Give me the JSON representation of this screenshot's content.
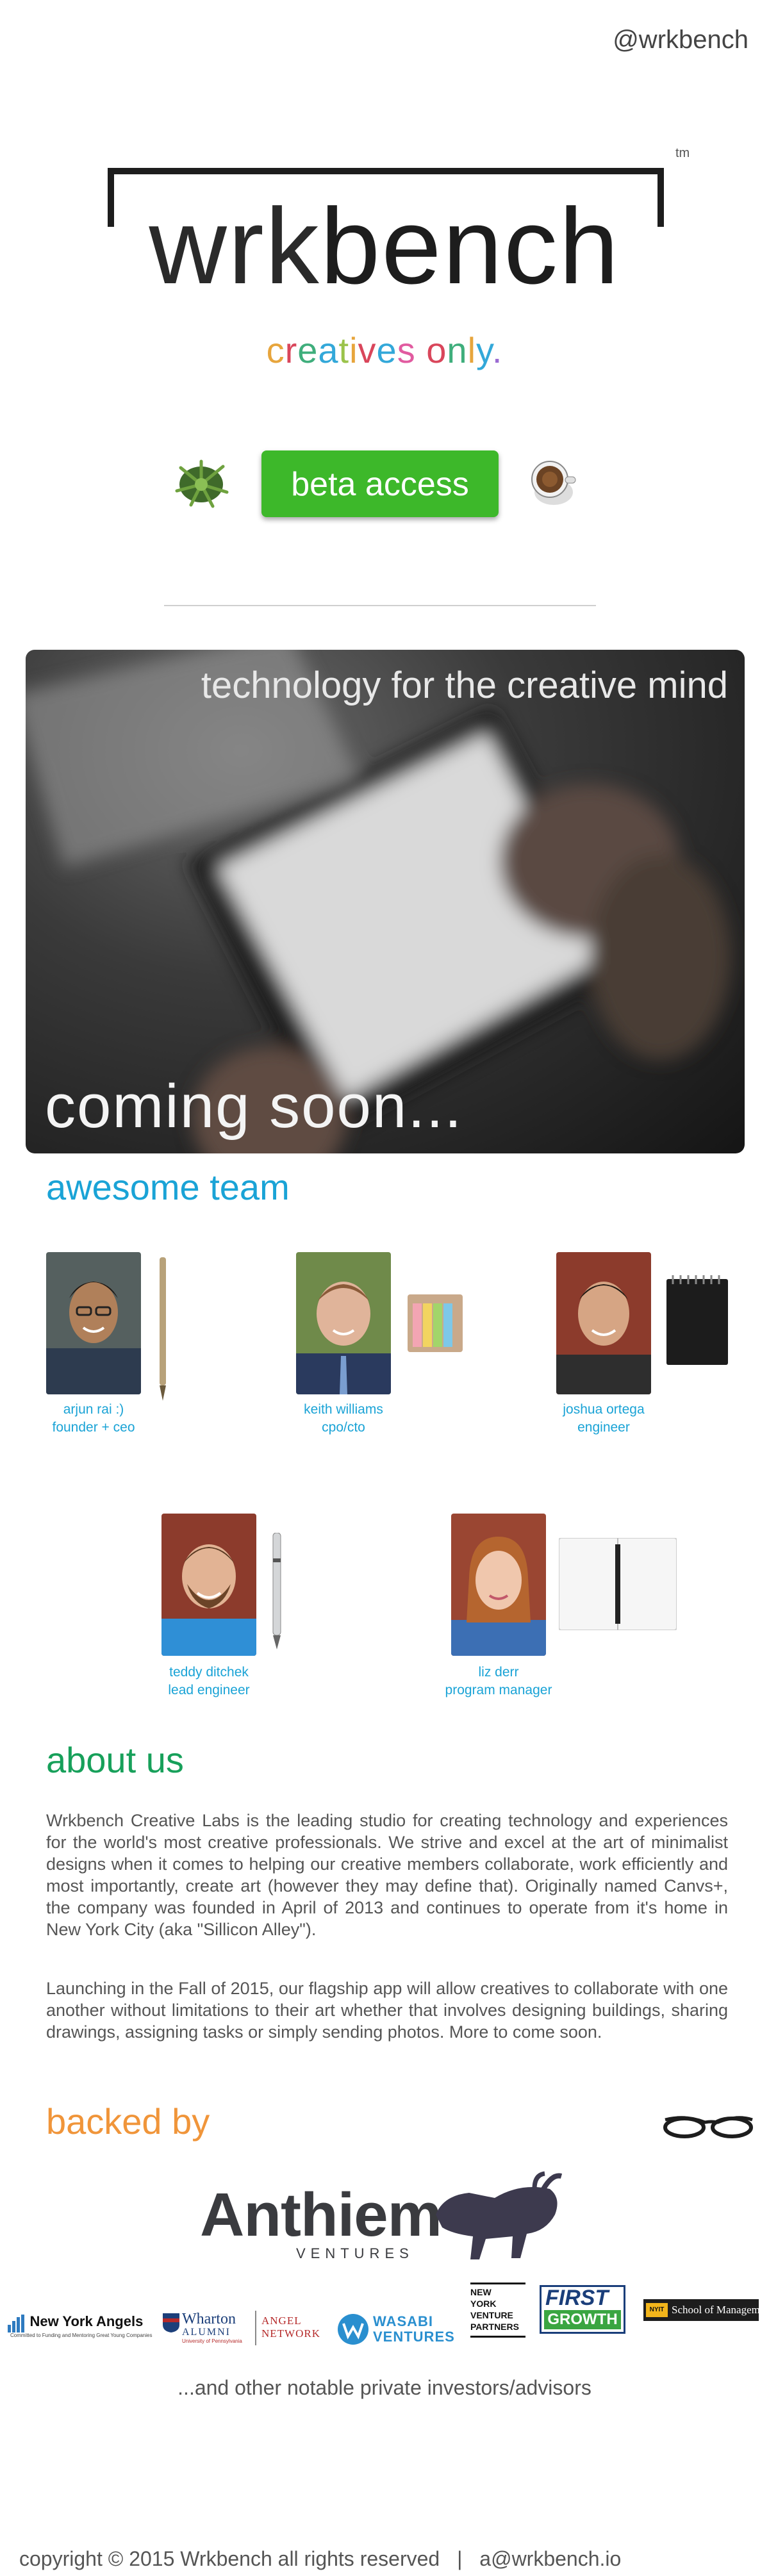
{
  "header": {
    "handle": "@wrkbench"
  },
  "logo": {
    "tm": "tm",
    "text_light": "wrk",
    "text_bold": "bench"
  },
  "tagline": {
    "letters": [
      {
        "ch": "c",
        "color": "#e7a53c"
      },
      {
        "ch": "r",
        "color": "#d9465b"
      },
      {
        "ch": "e",
        "color": "#3fae7c"
      },
      {
        "ch": "a",
        "color": "#33a8d9"
      },
      {
        "ch": "t",
        "color": "#9bc34b"
      },
      {
        "ch": "i",
        "color": "#e7a53c"
      },
      {
        "ch": "v",
        "color": "#d9465b"
      },
      {
        "ch": "e",
        "color": "#33a8d9"
      },
      {
        "ch": "s",
        "color": "#e15ba0"
      },
      {
        "ch": " ",
        "color": "#ffffff"
      },
      {
        "ch": "o",
        "color": "#d9465b"
      },
      {
        "ch": "n",
        "color": "#3fae7c"
      },
      {
        "ch": "l",
        "color": "#e7a53c"
      },
      {
        "ch": "y",
        "color": "#33a8d9"
      },
      {
        "ch": ".",
        "color": "#9b6bd2"
      }
    ]
  },
  "cta": {
    "beta_label": "beta access"
  },
  "hero": {
    "headline": "technology for the creative mind",
    "soon": "coming soon..."
  },
  "team": {
    "title": "awesome team",
    "members": [
      {
        "name": "arjun rai :)",
        "role": "founder + ceo"
      },
      {
        "name": "keith williams",
        "role": "cpo/cto"
      },
      {
        "name": "joshua ortega",
        "role": "engineer"
      },
      {
        "name": "teddy ditchek",
        "role": "lead engineer"
      },
      {
        "name": "liz derr",
        "role": "program manager"
      }
    ]
  },
  "about": {
    "title": "about us",
    "p1": "Wrkbench Creative Labs is the leading studio for creating technology and experiences for the world's most creative professionals. We strive and excel at the art of minimalist designs when it comes to helping our creative members collaborate, work efficiently and most importantly, create art (however they may define that). Originally named Canvs+, the company was founded in April of 2013 and continues to operate from it's home in New York City (aka \"Sillicon Alley\").",
    "p2": "Launching in the Fall of 2015, our flagship app will allow creatives to collaborate with one another without limitations to their art whether that involves designing buildings, sharing drawings, assigning tasks or simply sending photos. More to come soon."
  },
  "backed": {
    "title": "backed by",
    "anthiem": "Anthiem",
    "ventures": "VENTURES",
    "investors": {
      "nya": "New York Angels",
      "nya_sub": "Committed to Funding and Mentoring Great Young Companies",
      "wharton": "Wharton",
      "wharton_alumni": "ALUMNI",
      "wharton_sub": "University of Pennsylvania",
      "angel": "ANGEL",
      "network": "NETWORK",
      "wasabi1": "WASABI",
      "wasabi2": "VENTURES",
      "nyvp": "NEW YORK VENTURE PARTNERS",
      "first": "FIRST",
      "growth": "GROWTH",
      "som_tag": "NYIT",
      "som": "School of Management"
    },
    "others": "...and other notable private investors/advisors"
  },
  "footer": {
    "copyright": "copyright © 2015 Wrkbench all rights reserved",
    "sep": "|",
    "email": "a@wrkbench.io"
  },
  "colors": {
    "accent_blue": "#1aa3d6",
    "accent_green": "#17a05a",
    "accent_orange": "#f0953a",
    "cta_green": "#3db82a"
  }
}
